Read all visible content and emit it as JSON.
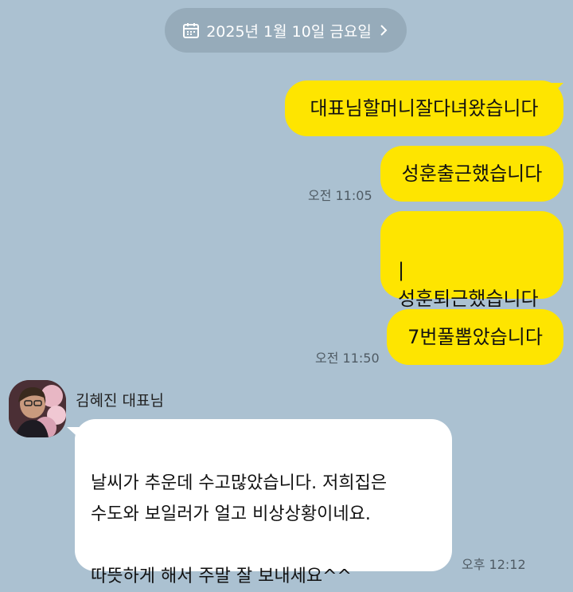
{
  "date_divider": {
    "label": "2025년 1월 10일 금요일",
    "icon": "calendar-icon",
    "chevron": "chevron-right-icon"
  },
  "messages": [
    {
      "sender": "me",
      "text": "대표님할머니잘다녀왔습니다",
      "time": ""
    },
    {
      "sender": "me",
      "text": "성훈출근했습니다",
      "time": "오전 11:05"
    },
    {
      "sender": "me",
      "text": "|\n성훈퇴근했습니다",
      "time": ""
    },
    {
      "sender": "me",
      "text": "7번풀뽑았습니다",
      "time": "오전 11:50"
    },
    {
      "sender": "김혜진 대표님",
      "text": "날씨가 추운데 수고많았습니다. 저희집은\n수도와 보일러가 얼고  비상상황이네요.\n\n따뜻하게 해서 주말 잘 보내세요^^",
      "time": "오후 12:12"
    }
  ],
  "colors": {
    "background": "#abc1d1",
    "my_bubble": "#fee500",
    "other_bubble": "#ffffff",
    "date_pill": "#96abba"
  }
}
